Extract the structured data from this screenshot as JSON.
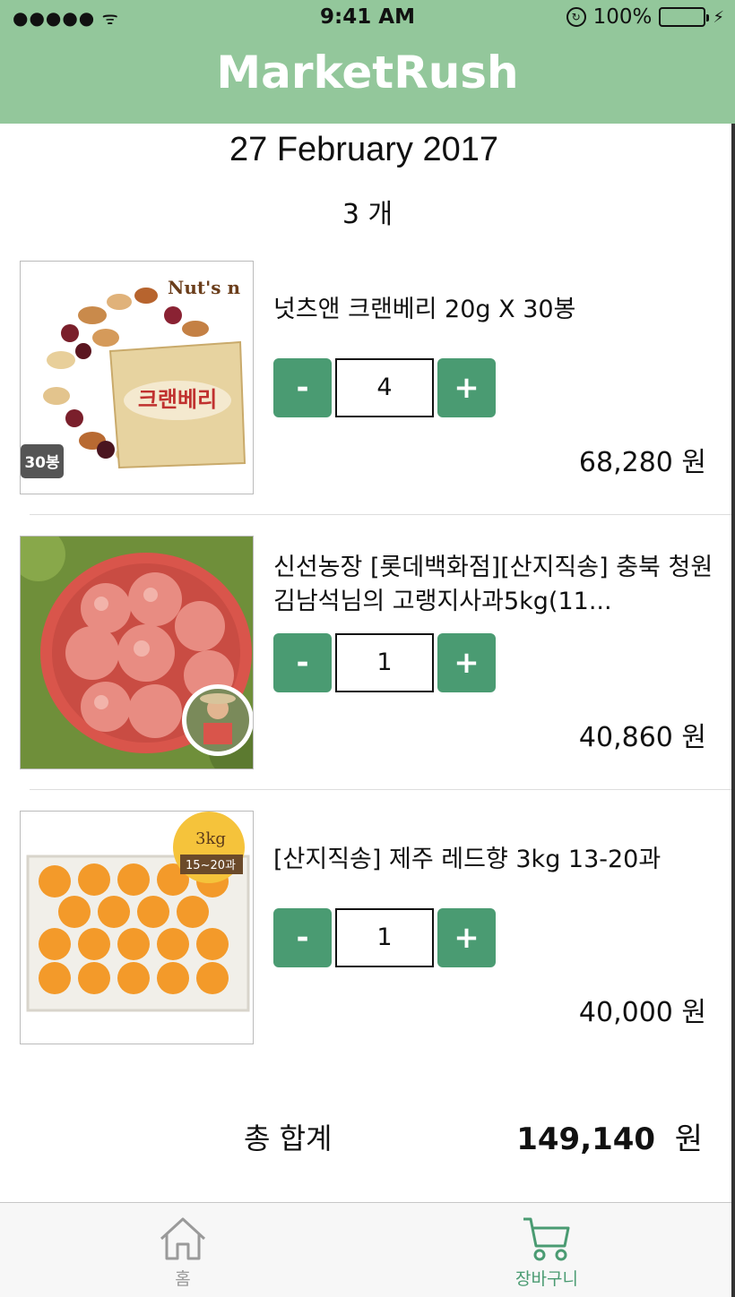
{
  "status_bar": {
    "signal": "●●●●● ᯤ",
    "time": "9:41 AM",
    "battery": "100%",
    "battery_level": 1.0
  },
  "header": {
    "title": "MarketRush"
  },
  "cart": {
    "date": "27 February 2017",
    "count_label": "3 개",
    "items": [
      {
        "name": "넛츠앤 크랜베리 20g X 30봉",
        "quantity": "4",
        "price": "68,280 원",
        "thumb_badge": "30봉",
        "thumb_brand": "Nut's n",
        "thumb_pack_text": "크랜베리"
      },
      {
        "name": "신선농장 [롯데백화점][산지직송] 충북 청원 김남석님의 고랭지사과5kg(11...",
        "quantity": "1",
        "price": "40,860 원"
      },
      {
        "name": "[산지직송] 제주 레드향 3kg 13-20과",
        "quantity": "1",
        "price": "40,000 원",
        "thumb_badge_top": "3kg",
        "thumb_badge_bottom": "15~20과"
      }
    ],
    "minus_label": "-",
    "plus_label": "+"
  },
  "total": {
    "label": "총 합계",
    "amount": "149,140",
    "unit": "원"
  },
  "tabbar": {
    "tabs": [
      {
        "label": "홈",
        "icon": "home-icon"
      },
      {
        "label": "장바구니",
        "icon": "cart-icon"
      }
    ]
  },
  "colors": {
    "nav_bar": "#93c79b",
    "accent": "#4a9b72",
    "title_text": "#ffffff"
  }
}
